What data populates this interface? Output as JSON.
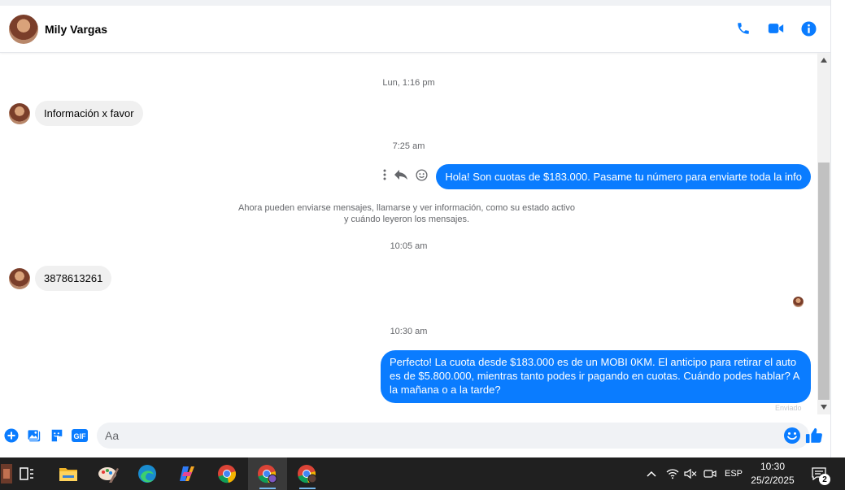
{
  "header": {
    "contact_name": "Mily Vargas",
    "icons": [
      "phone-icon",
      "video-camera-icon",
      "info-icon"
    ]
  },
  "thread": {
    "timestamp_1": "Lun, 1:16 pm",
    "msg_in_1": "Información x favor",
    "timestamp_2": "7:25 am",
    "msg_out_1": "Hola! Son cuotas de $183.000. Pasame tu número para enviarte toda la info",
    "notice_line_1": "Ahora pueden enviarse mensajes, llamarse y ver información, como su estado activo",
    "notice_line_2": "y cuándo leyeron los mensajes.",
    "timestamp_3": "10:05 am",
    "msg_in_2": "3878613261",
    "timestamp_4": "10:30 am",
    "msg_out_2": "Perfecto! La cuota desde $183.000 es de un MOBI 0KM. El anticipo para retirar el auto es de $5.800.000, mientras tanto podes ir pagando en cuotas. Cuándo podes hablar? A la mañana o a la tarde?",
    "sent_status": "Enviado"
  },
  "composer": {
    "placeholder": "Aa",
    "icons": [
      "plus-icon",
      "photo-icon",
      "sticker-icon",
      "gif-icon",
      "emoji-icon",
      "thumbs-up-icon"
    ],
    "gif_label": "GIF"
  },
  "colors": {
    "accent": "#0a7cff",
    "incoming_bubble": "#f0f0f0",
    "taskbar": "#202020"
  },
  "taskbar": {
    "apps": [
      "task-view-icon",
      "file-explorer-icon",
      "paint-icon",
      "edge-icon",
      "copilot-icon",
      "chrome-icon",
      "chrome-profile-icon",
      "chrome-profile-2-icon"
    ],
    "language": "ESP",
    "time": "10:30",
    "date": "25/2/2025",
    "notifications": "2"
  }
}
